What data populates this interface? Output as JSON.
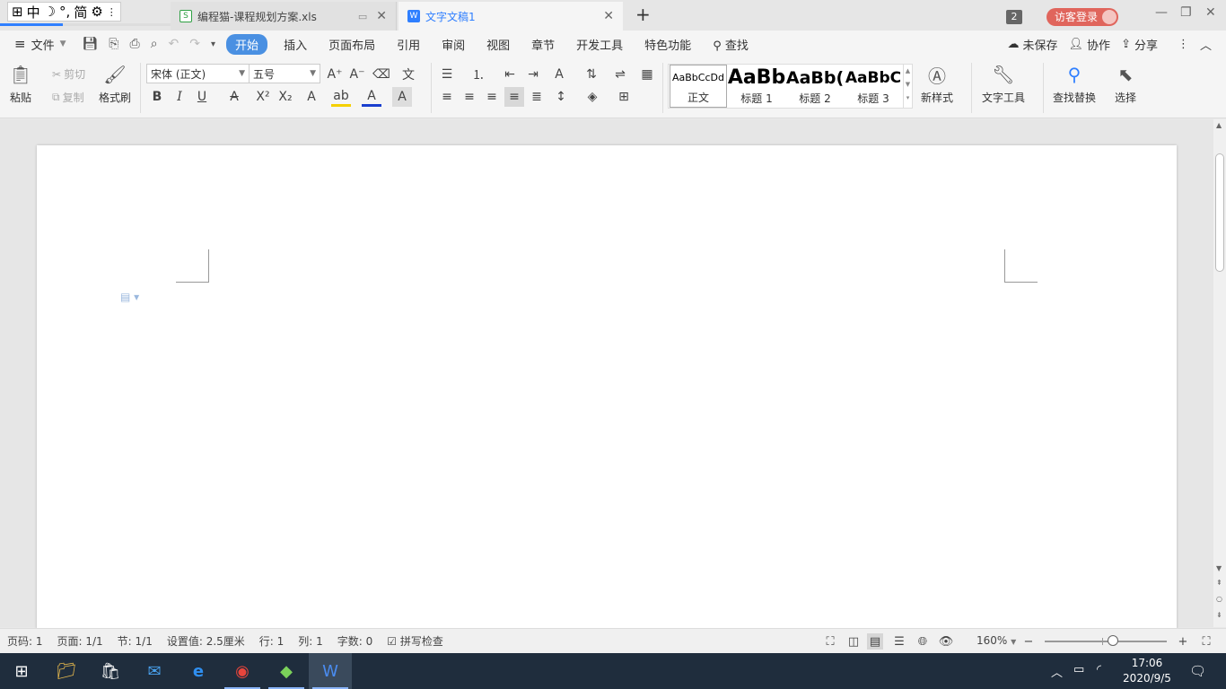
{
  "ime_bar": {
    "mode_label": "中",
    "punct_label": "°,",
    "script_label": "简"
  },
  "tabs": [
    {
      "title": "编程猫-课程规划方案.xls",
      "icon": "spreadsheet-icon",
      "active": false,
      "accent": "#2ea043"
    },
    {
      "title": "文字文稿1",
      "icon": "writer-doc-icon",
      "active": true,
      "accent": "#2f7fff"
    }
  ],
  "window": {
    "badge_count": "2",
    "login_label": "访客登录"
  },
  "menu": {
    "file_label": "文件",
    "items": [
      "开始",
      "插入",
      "页面布局",
      "引用",
      "审阅",
      "视图",
      "章节",
      "开发工具",
      "特色功能"
    ],
    "search_label": "查找",
    "unsaved_label": "未保存",
    "collab_label": "协作",
    "share_label": "分享"
  },
  "ribbon": {
    "paste_label": "粘贴",
    "cut_label": "剪切",
    "copy_label": "复制",
    "format_painter_label": "格式刷",
    "font_name": "宋体 (正文)",
    "font_size": "五号",
    "styles": [
      {
        "preview": "AaBbCcDd",
        "label": "正文"
      },
      {
        "preview": "AaBb",
        "label": "标题 1"
      },
      {
        "preview": "AaBb(",
        "label": "标题 2"
      },
      {
        "preview": "AaBbC",
        "label": "标题 3"
      }
    ],
    "new_style_label": "新样式",
    "text_tools_label": "文字工具",
    "find_replace_label": "查找替换",
    "select_label": "选择"
  },
  "status": {
    "page_no": "页码: 1",
    "pages": "页面: 1/1",
    "section": "节: 1/1",
    "setting": "设置值: 2.5厘米",
    "row": "行: 1",
    "col": "列: 1",
    "word_count": "字数: 0",
    "spellcheck": "拼写检查",
    "zoom": "160%",
    "zoom_level": 0.56
  },
  "taskbar": {
    "time": "17:06",
    "date": "2020/9/5"
  },
  "colors": {
    "accent": "#4a90e2",
    "login": "#e0655c",
    "taskbar": "#1f2d3d"
  }
}
